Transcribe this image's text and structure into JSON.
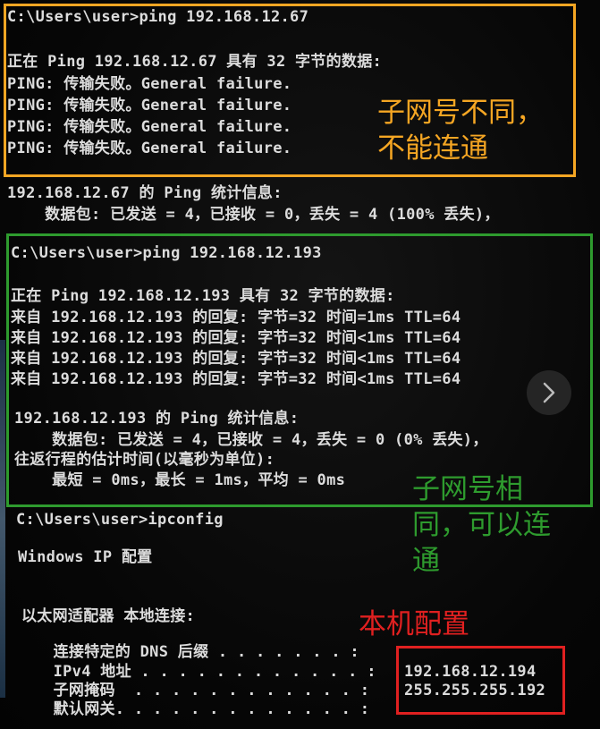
{
  "colors": {
    "orange": "#f5a623",
    "green": "#2e9b2e",
    "red": "#e02020",
    "terminal_text": "#dcdcdc"
  },
  "terminal": {
    "block1": {
      "prompt": "C:\\Users\\user>ping 192.168.12.67",
      "header": "正在 Ping 192.168.12.67 具有 32 字节的数据:",
      "replies": [
        "PING: 传输失败。General failure.",
        "PING: 传输失败。General failure.",
        "PING: 传输失败。General failure.",
        "PING: 传输失败。General failure."
      ],
      "stats_title": "192.168.12.67 的 Ping 统计信息:",
      "stats_packets": "    数据包: 已发送 = 4，已接收 = 0，丢失 = 4 (100% 丢失)，"
    },
    "block2": {
      "prompt": "C:\\Users\\user>ping 192.168.12.193",
      "header": "正在 Ping 192.168.12.193 具有 32 字节的数据:",
      "replies": [
        "来自 192.168.12.193 的回复: 字节=32 时间=1ms TTL=64",
        "来自 192.168.12.193 的回复: 字节=32 时间<1ms TTL=64",
        "来自 192.168.12.193 的回复: 字节=32 时间<1ms TTL=64",
        "来自 192.168.12.193 的回复: 字节=32 时间<1ms TTL=64"
      ],
      "stats_title": "192.168.12.193 的 Ping 统计信息:",
      "stats_packets": "    数据包: 已发送 = 4，已接收 = 4，丢失 = 0 (0% 丢失)，",
      "rtt_title": "往返行程的估计时间(以毫秒为单位):",
      "rtt_values": "    最短 = 0ms，最长 = 1ms，平均 = 0ms"
    },
    "block3": {
      "prompt": "C:\\Users\\user>ipconfig",
      "title": "Windows IP 配置",
      "adapter": "以太网适配器 本地连接:",
      "dns_label": "   连接特定的 DNS 后缀 . . . . . . . :",
      "ipv4_label": "   IPv4 地址 . . . . . . . . . . . . :",
      "mask_label": "   子网掩码  . . . . . . . . . . . . :",
      "gateway_label": "   默认网关. . . . . . . . . . . . . :",
      "ipv4_value": "192.168.12.194",
      "mask_value": "255.255.255.192"
    }
  },
  "annotations": {
    "different_subnet": "子网号不同，\n不能连通",
    "same_subnet": "子网号相\n同，可以连\n通",
    "local_config": "本机配置"
  },
  "controls": {
    "next_icon": "chevron-right-icon"
  }
}
